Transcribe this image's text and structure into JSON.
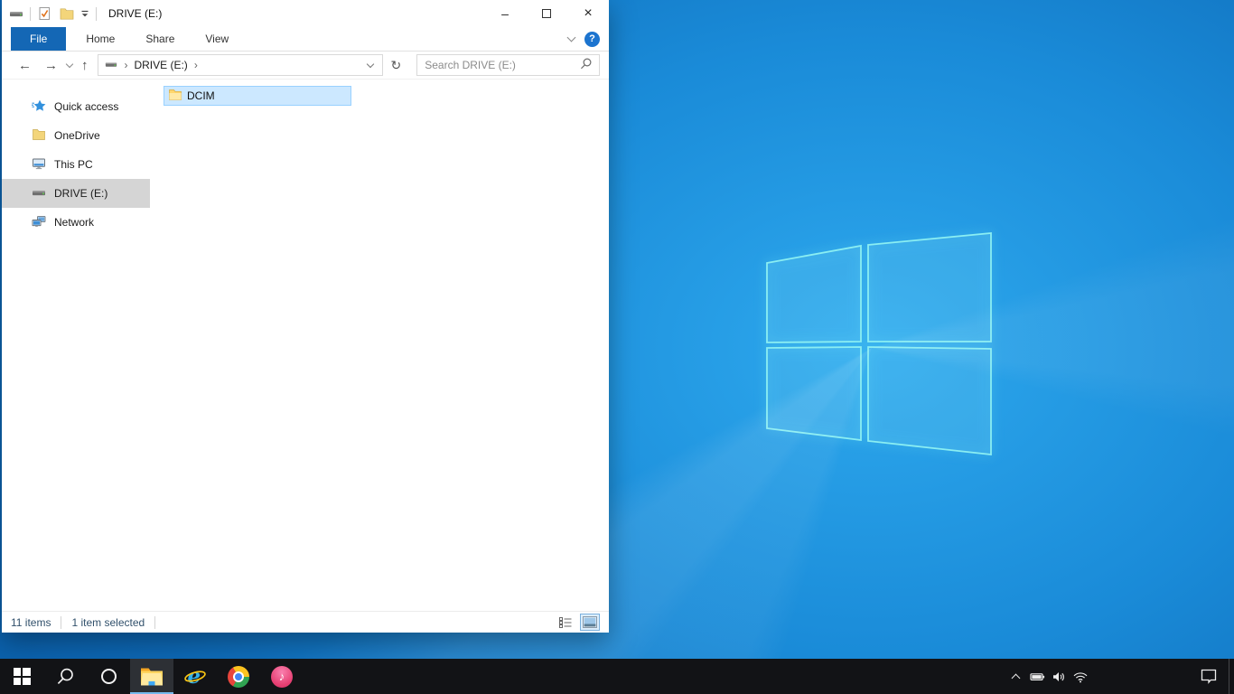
{
  "colors": {
    "accent_blue": "#1467b5",
    "selection_fill": "#cce8ff",
    "selection_border": "#99d1ff",
    "sidebar_selected_gray": "#d5d5d5",
    "taskbar_bg": "#121316",
    "taskbar_active_underline": "#76b9ed",
    "desktop_blue_center": "#2ea9ee",
    "desktop_blue_outer": "#0a5ea9",
    "logo_stroke": "#8aeef2"
  },
  "icons": {
    "minimize": "–",
    "close": "×",
    "help": "?",
    "back": "←",
    "forward": "→",
    "up": "↑",
    "refresh": "↻",
    "breadcrumb_sep": "›",
    "itunes_note": "♪"
  },
  "explorer": {
    "title": "DRIVE (E:)",
    "ribbon": {
      "tabs": [
        {
          "label": "File",
          "active": true
        },
        {
          "label": "Home",
          "active": false
        },
        {
          "label": "Share",
          "active": false
        },
        {
          "label": "View",
          "active": false
        }
      ]
    },
    "breadcrumb": {
      "location": "DRIVE (E:)"
    },
    "search": {
      "placeholder": "Search DRIVE (E:)"
    },
    "sidebar": {
      "items": [
        {
          "label": "Quick access",
          "icon": "quick-access-star-icon",
          "selected": false
        },
        {
          "label": "OneDrive",
          "icon": "onedrive-folder-icon",
          "selected": false
        },
        {
          "label": "This PC",
          "icon": "this-pc-icon",
          "selected": false
        },
        {
          "label": "DRIVE (E:)",
          "icon": "drive-icon",
          "selected": true
        },
        {
          "label": "Network",
          "icon": "network-icon",
          "selected": false
        }
      ]
    },
    "files": [
      {
        "name": "DCIM",
        "icon": "folder-icon",
        "selected": true
      }
    ],
    "status": {
      "total": "11 items",
      "selected": "1 item selected",
      "view_buttons": [
        "details-view",
        "thumbnail-view"
      ],
      "active_view": "thumbnail-view"
    }
  },
  "taskbar": {
    "items": [
      "start",
      "search",
      "cortana",
      "file-explorer",
      "internet-explorer",
      "chrome",
      "itunes"
    ],
    "active_item": "file-explorer",
    "tray_items": [
      "hidden-icons-chevron",
      "battery",
      "volume",
      "wifi"
    ],
    "action_center": "action-center"
  }
}
